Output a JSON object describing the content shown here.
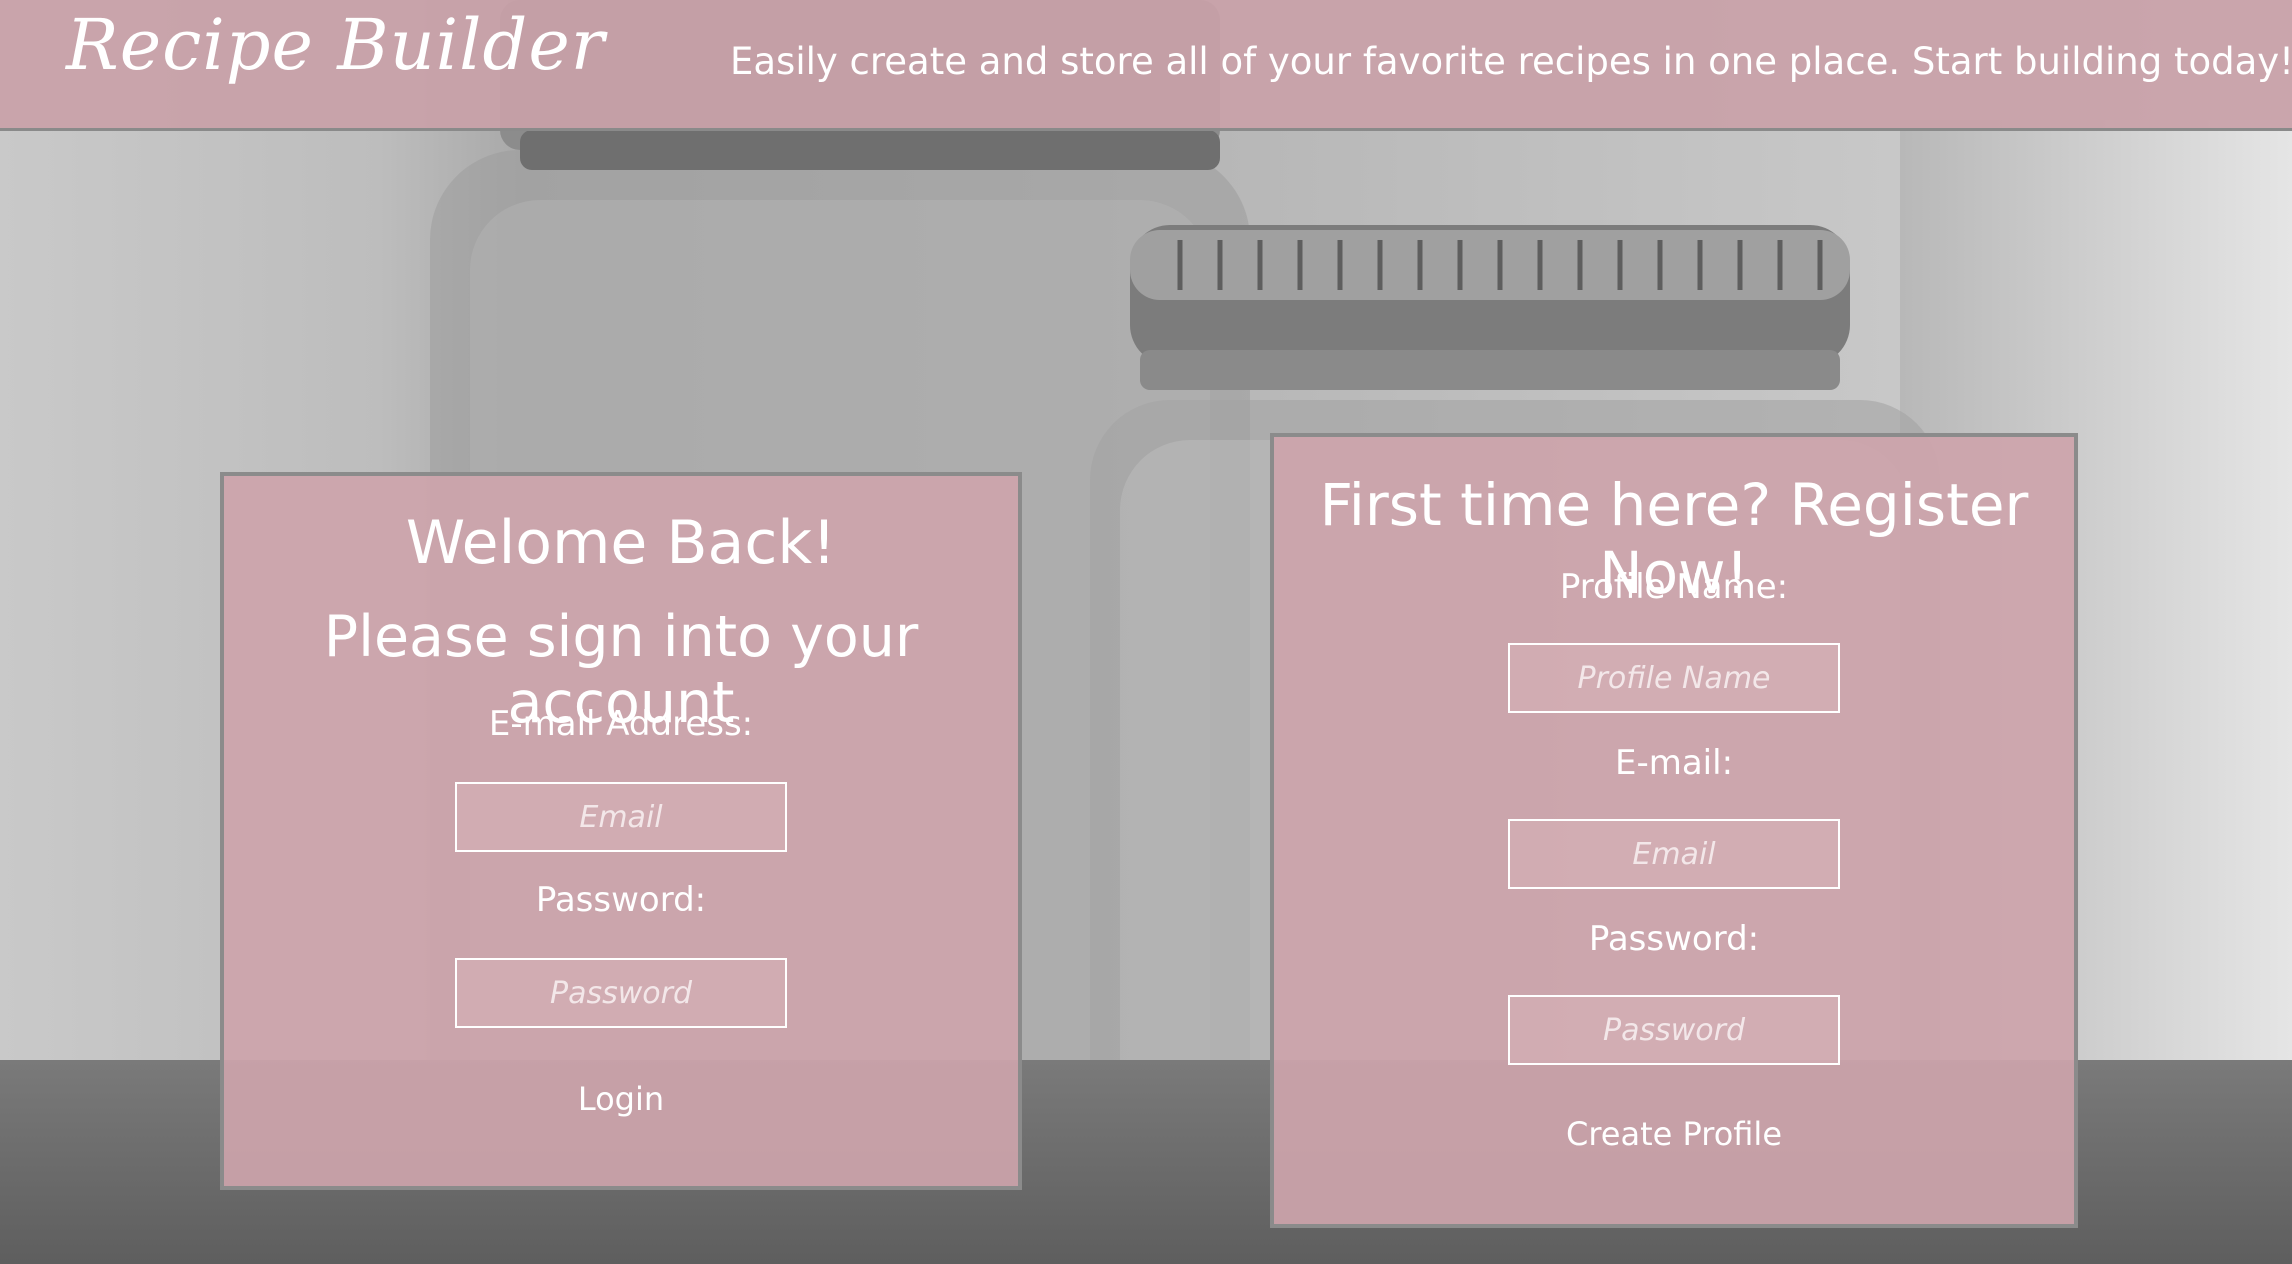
{
  "header": {
    "brand": "Recipe Builder",
    "tagline": "Easily create and store all of your favorite recipes in one place. Start building today!"
  },
  "login": {
    "welcome": "Welome Back!",
    "subtitle": "Please sign into your account",
    "email_label": "E-mail Address:",
    "email_placeholder": "Email",
    "password_label": "Password:",
    "password_placeholder": "Password",
    "button": "Login"
  },
  "register": {
    "title": "First time here? Register Now!",
    "profile_label": "Profile Name:",
    "profile_placeholder": "Profile Name",
    "email_label": "E-mail:",
    "email_placeholder": "Email",
    "password_label": "Password:",
    "password_placeholder": "Password",
    "button": "Create Profile"
  },
  "colors": {
    "panel": "#cda4ab",
    "header": "#c9a1a8",
    "border": "#8b8b8b",
    "text": "#ffffff"
  }
}
